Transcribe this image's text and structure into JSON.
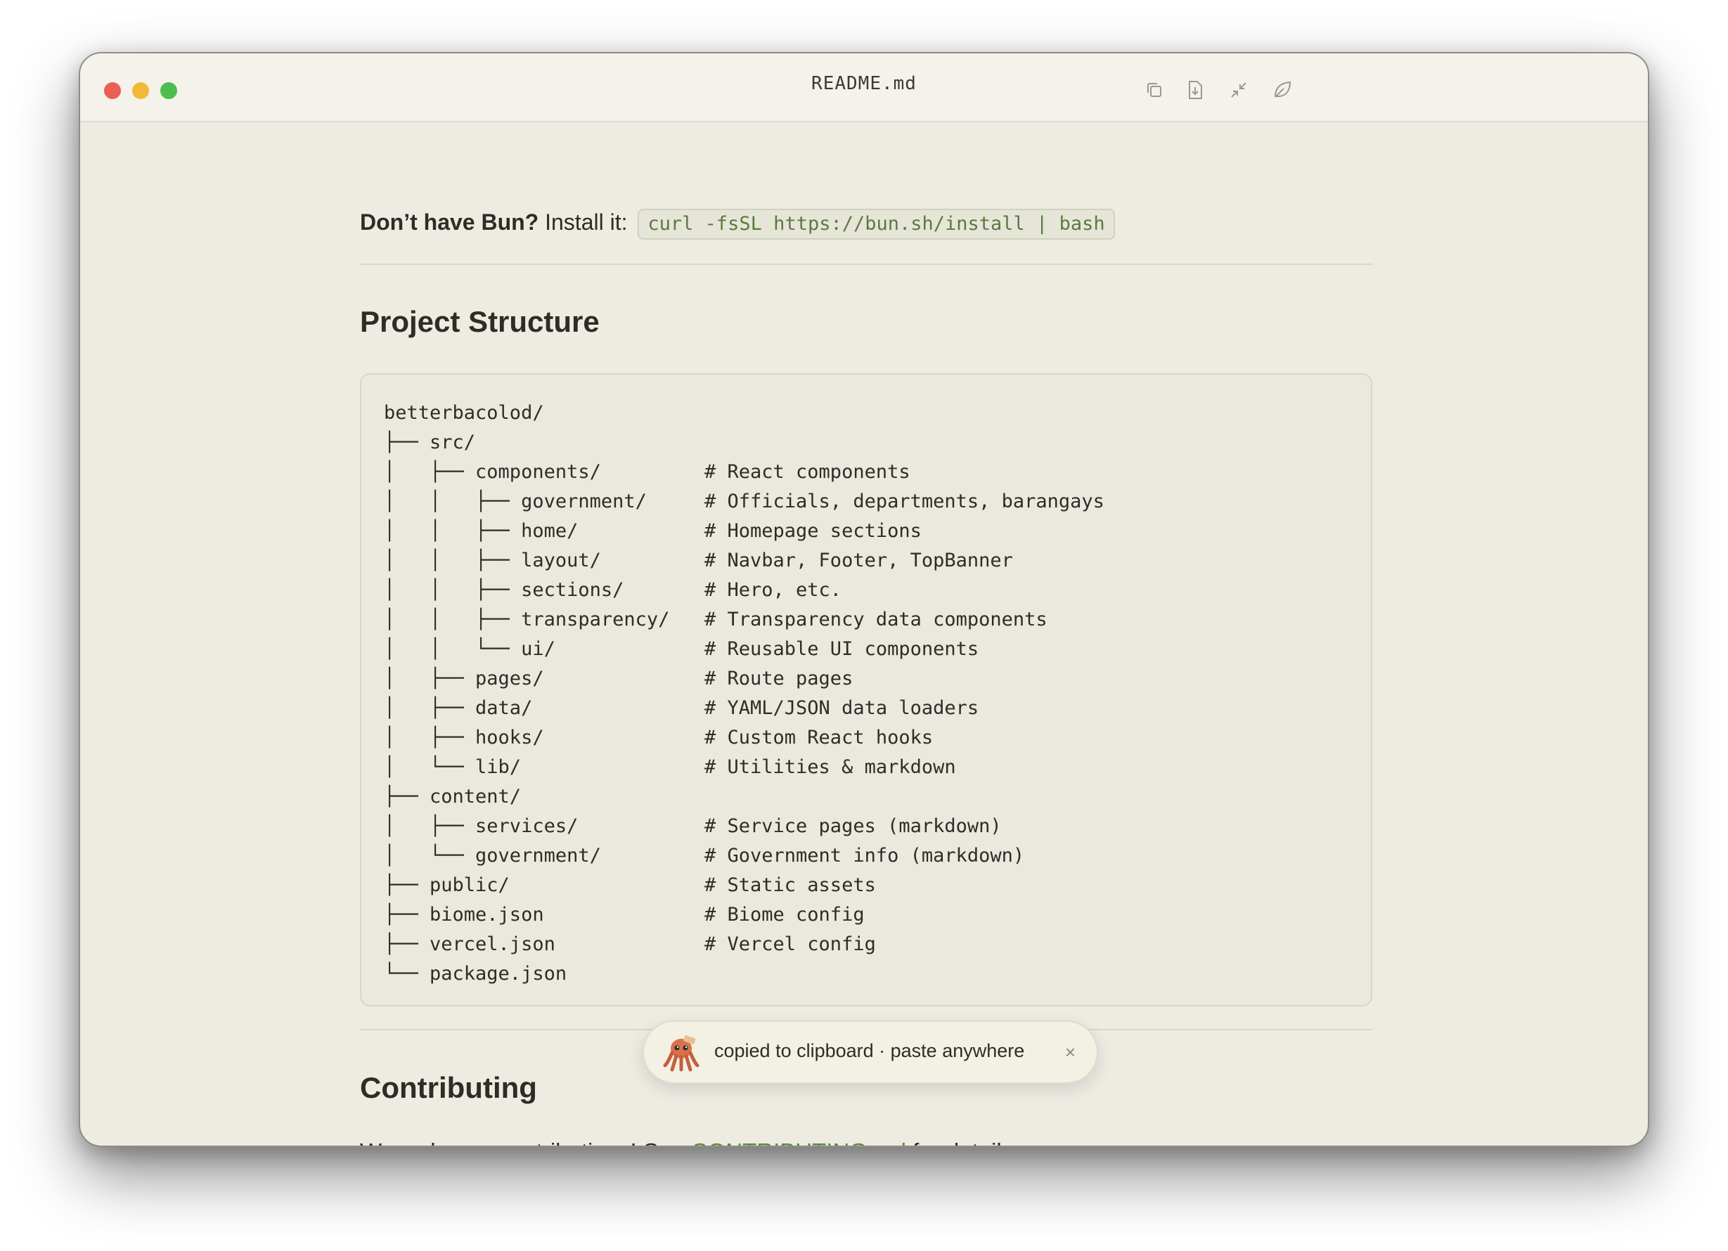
{
  "window": {
    "title": "README.md",
    "toolbar_icons": [
      "copy-icon",
      "download-icon",
      "collapse-icon",
      "leaf-icon"
    ]
  },
  "install": {
    "bold": "Don’t have Bun?",
    "text": "Install it:",
    "code": "curl -fsSL https://bun.sh/install | bash"
  },
  "project_structure": {
    "heading": "Project Structure",
    "lines": [
      {
        "tree": "betterbacolod/",
        "comment": ""
      },
      {
        "tree": "├── src/",
        "comment": ""
      },
      {
        "tree": "│   ├── components/",
        "comment": "# React components"
      },
      {
        "tree": "│   │   ├── government/",
        "comment": "# Officials, departments, barangays"
      },
      {
        "tree": "│   │   ├── home/",
        "comment": "# Homepage sections"
      },
      {
        "tree": "│   │   ├── layout/",
        "comment": "# Navbar, Footer, TopBanner"
      },
      {
        "tree": "│   │   ├── sections/",
        "comment": "# Hero, etc."
      },
      {
        "tree": "│   │   ├── transparency/",
        "comment": "# Transparency data components"
      },
      {
        "tree": "│   │   └── ui/",
        "comment": "# Reusable UI components"
      },
      {
        "tree": "│   ├── pages/",
        "comment": "# Route pages"
      },
      {
        "tree": "│   ├── data/",
        "comment": "# YAML/JSON data loaders"
      },
      {
        "tree": "│   ├── hooks/",
        "comment": "# Custom React hooks"
      },
      {
        "tree": "│   └── lib/",
        "comment": "# Utilities & markdown"
      },
      {
        "tree": "├── content/",
        "comment": ""
      },
      {
        "tree": "│   ├── services/",
        "comment": "# Service pages (markdown)"
      },
      {
        "tree": "│   └── government/",
        "comment": "# Government info (markdown)"
      },
      {
        "tree": "├── public/",
        "comment": "# Static assets"
      },
      {
        "tree": "├── biome.json",
        "comment": "# Biome config"
      },
      {
        "tree": "├── vercel.json",
        "comment": "# Vercel config"
      },
      {
        "tree": "└── package.json",
        "comment": ""
      }
    ]
  },
  "contributing": {
    "heading": "Contributing",
    "text_before": "We welcome contributions! See",
    "link": "CONTRIBUTING.md",
    "text_after": "for details."
  },
  "toast": {
    "message": "copied to clipboard · paste anywhere",
    "close": "×",
    "icon": "octopus-mascot-icon"
  }
}
